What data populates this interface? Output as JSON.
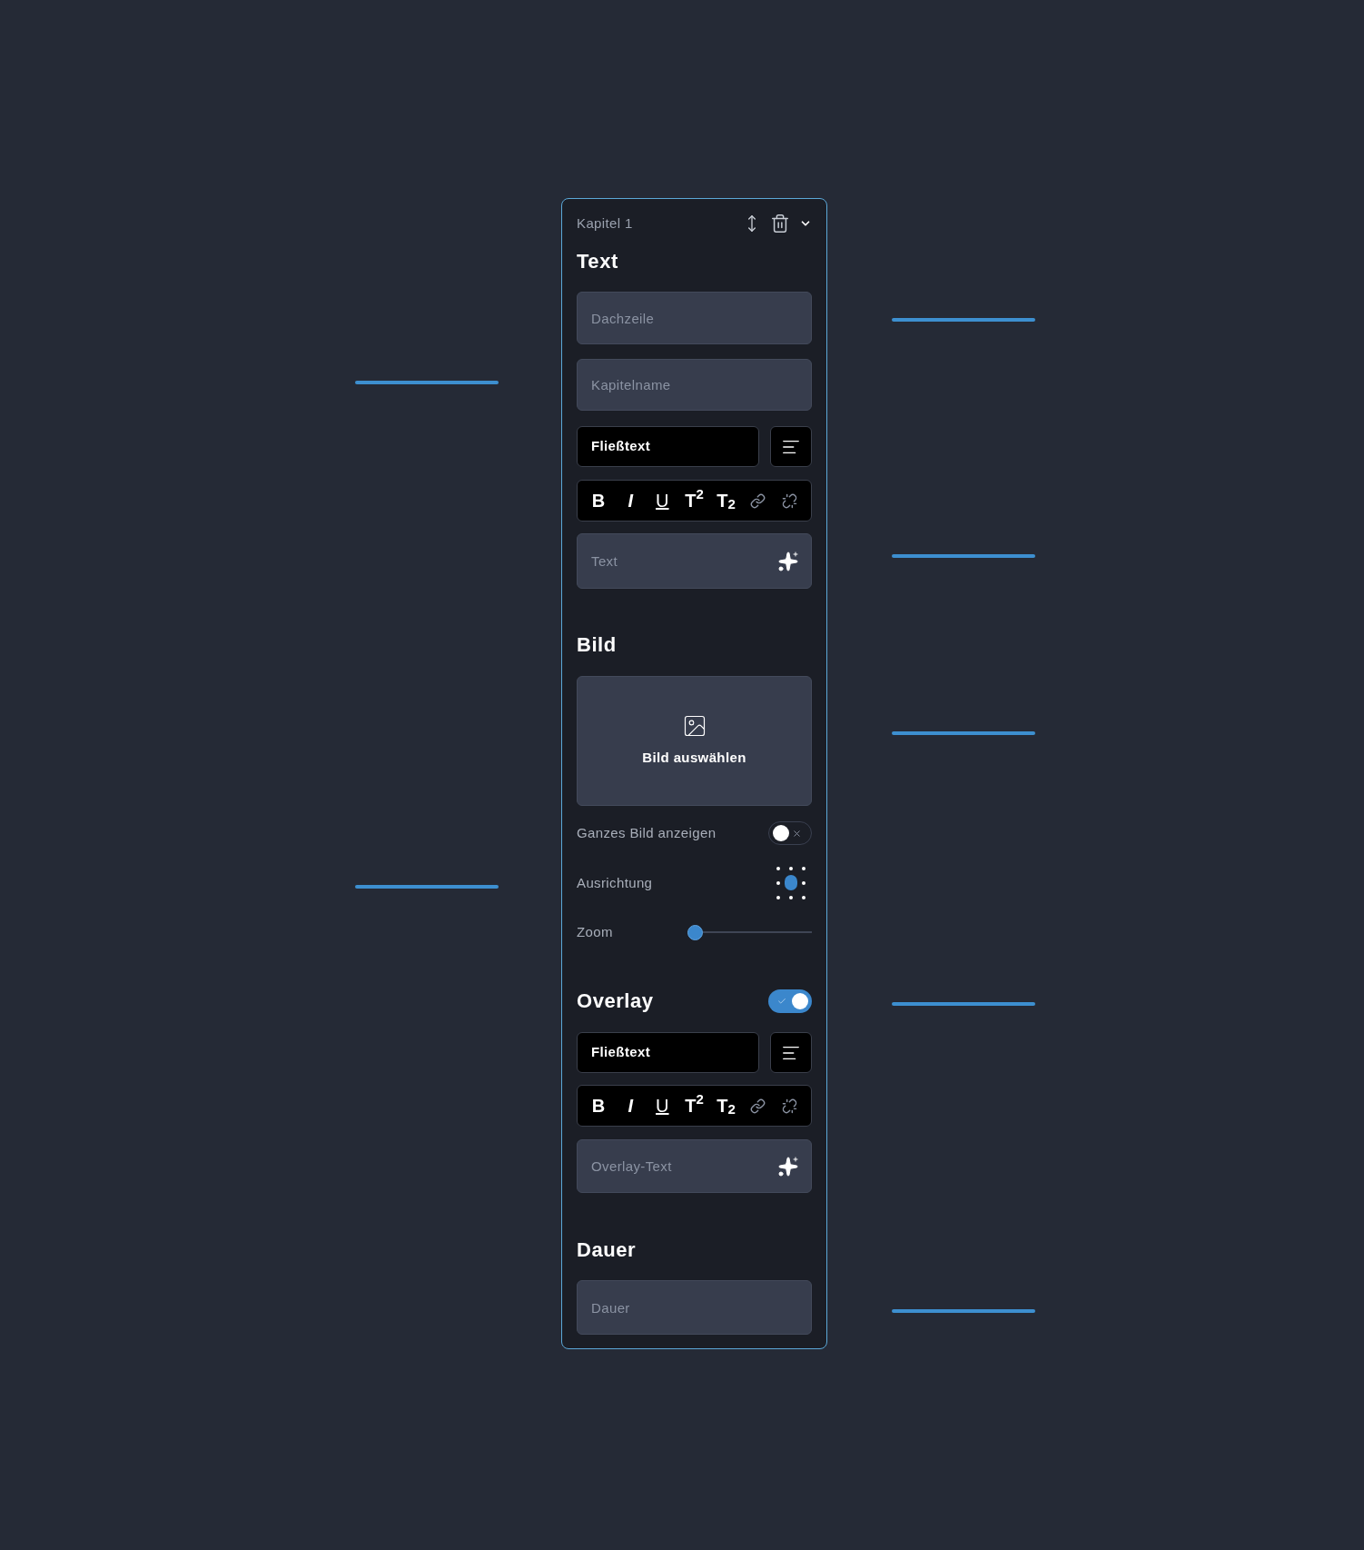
{
  "chapter_title": "Kapitel 1",
  "text_section": {
    "heading": "Text",
    "fields": [
      {
        "placeholder": "Dachzeile"
      },
      {
        "placeholder": "Kapitelname"
      }
    ],
    "style_select": {
      "value": "Fließtext"
    },
    "format_buttons": [
      {
        "kind": "bold",
        "label": "B"
      },
      {
        "kind": "italic",
        "label": "I"
      },
      {
        "kind": "underline",
        "label": "U"
      },
      {
        "kind": "superscript",
        "label": "T$^{2}$"
      },
      {
        "kind": "subscript",
        "label": "T$_{2}$"
      },
      {
        "kind": "link"
      },
      {
        "kind": "unlink"
      }
    ],
    "textarea": {
      "placeholder": "Text"
    }
  },
  "image_section": {
    "heading": "Bild",
    "picker_label": "Bild auswählen",
    "options": [
      {
        "kind": "toggle",
        "label": "Ganzes Bild anzeigen",
        "on": false
      },
      {
        "kind": "alignment",
        "label": "Ausrichtung",
        "positions": [
          {
            "selected": false
          },
          {
            "selected": false
          },
          {
            "selected": false
          },
          {
            "selected": false
          },
          {
            "selected": true
          },
          {
            "selected": false
          },
          {
            "selected": false
          },
          {
            "selected": false
          },
          {
            "selected": false
          }
        ]
      },
      {
        "kind": "slider",
        "label": "Zoom",
        "level": 0
      }
    ]
  },
  "overlay_section": {
    "heading": "Overlay",
    "on": true,
    "style_select": {
      "value": "Fließtext"
    },
    "format_buttons": [
      {
        "kind": "bold",
        "label": "B"
      },
      {
        "kind": "italic",
        "label": "I"
      },
      {
        "kind": "underline",
        "label": "U"
      },
      {
        "kind": "superscript",
        "label": "T$^{2}$"
      },
      {
        "kind": "subscript",
        "label": "T$_{2}$"
      },
      {
        "kind": "link"
      },
      {
        "kind": "unlink"
      }
    ],
    "textarea": {
      "placeholder": "Overlay-Text"
    }
  },
  "duration_section": {
    "heading": "Dauer",
    "field": {
      "placeholder": "Dauer"
    }
  }
}
